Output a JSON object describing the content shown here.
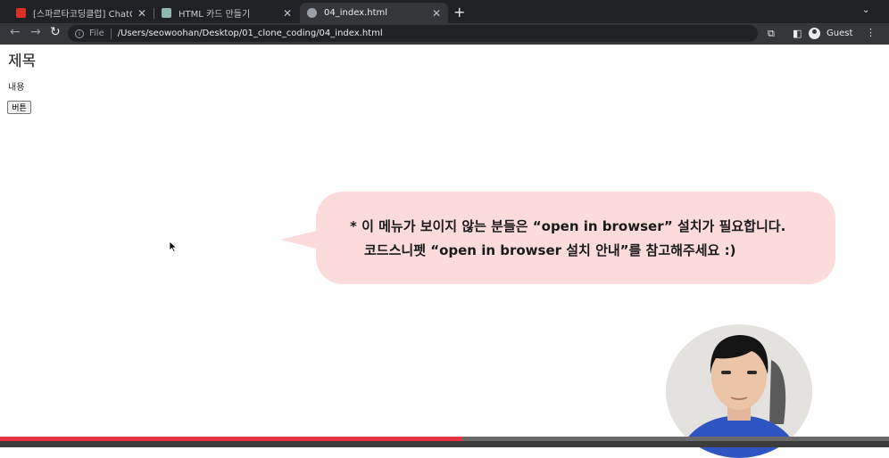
{
  "browser": {
    "tabs": [
      {
        "title": "[스파르타코딩클럽] ChatGPT 클론",
        "favicon_color": "#d93025",
        "active": false
      },
      {
        "title": "HTML 카드 만들기",
        "favicon_color": "#8fb7b2",
        "active": false
      },
      {
        "title": "04_index.html",
        "favicon_color": "#9aa0a6",
        "active": true
      }
    ],
    "address_bar": {
      "scheme_label": "File",
      "url": "/Users/seowoohan/Desktop/01_clone_coding/04_index.html"
    },
    "profile_label": "Guest"
  },
  "page": {
    "heading": "제목",
    "paragraph": "내용",
    "button_label": "버튼"
  },
  "overlay": {
    "bubble_line1": "* 이 메뉴가 보이지 않는 분들은 “open in browser” 설치가 필요합니다.",
    "bubble_line2": "코드스니펫 “open in browser 설치 안내”를 참고해주세요 :)",
    "bubble_color": "#fcdcdb"
  },
  "video": {
    "progress_fraction": 0.52,
    "progress_color": "#e53541"
  }
}
